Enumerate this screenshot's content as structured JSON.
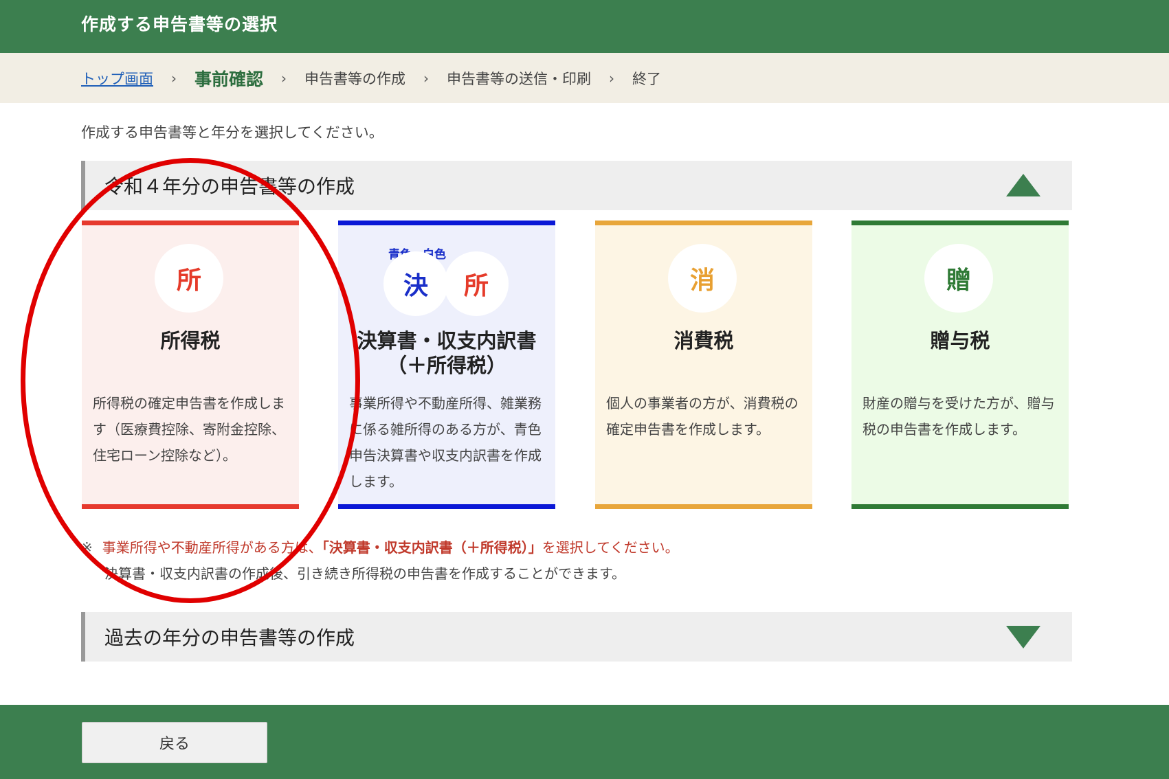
{
  "header": {
    "title": "作成する申告書等の選択"
  },
  "breadcrumb": {
    "items": [
      "トップ画面",
      "事前確認",
      "申告書等の作成",
      "申告書等の送信・印刷",
      "終了"
    ],
    "separator": "›"
  },
  "intro": "作成する申告書等と年分を選択してください。",
  "section_current": {
    "title": "令和４年分の申告書等の作成"
  },
  "cards": [
    {
      "icon_char": "所",
      "icon_name": "income-tax-icon",
      "title": "所得税",
      "description": "所得税の確定申告書を作成します（医療費控除、寄附金控除、住宅ローン控除など）。",
      "accent": "#e63a2e",
      "bg": "#fcefed",
      "icon_color": "#e53b2a"
    },
    {
      "icon_char": "決",
      "icon_char2": "所",
      "icon_name": "settlement-icon",
      "label_blue": "青色",
      "label_white": "白色",
      "title_line1": "決算書・収支内訳書",
      "title_line2": "（＋所得税）",
      "description": "事業所得や不動産所得、雑業務に係る雑所得のある方が、青色申告決算書や収支内訳書を作成します。",
      "accent": "#0a18d6",
      "bg": "#eef0fc",
      "icon_color": "#1a2fc9"
    },
    {
      "icon_char": "消",
      "icon_name": "consumption-tax-icon",
      "title": "消費税",
      "description": "個人の事業者の方が、消費税の確定申告書を作成します。",
      "accent": "#e8a63a",
      "bg": "#fdf5e4",
      "icon_color": "#e8a032"
    },
    {
      "icon_char": "贈",
      "icon_name": "gift-tax-icon",
      "title": "贈与税",
      "description": "財産の贈与を受けた方が、贈与税の申告書を作成します。",
      "accent": "#2f7a35",
      "bg": "#ecfbe6",
      "icon_color": "#2f7a35"
    }
  ],
  "notes": {
    "mark": "※",
    "line1_prefix": "事業所得や不動産所得がある方は、",
    "line1_strong": "「決算書・収支内訳書（＋所得税）」",
    "line1_suffix": "を選択してください。",
    "line2": "決算書・収支内訳書の作成後、引き続き所得税の申告書を作成することができます。"
  },
  "section_past": {
    "title": "過去の年分の申告書等の作成"
  },
  "footer": {
    "back_label": "戻る"
  }
}
